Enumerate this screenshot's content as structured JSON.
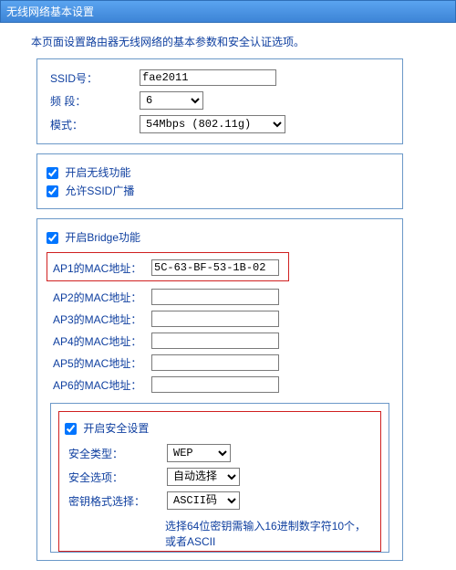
{
  "titlebar": "无线网络基本设置",
  "description": "本页面设置路由器无线网络的基本参数和安全认证选项。",
  "basic": {
    "ssid_label": "SSID号：",
    "ssid_value": "fae2011",
    "band_label": "频 段：",
    "band_value": "6",
    "mode_label": "模式：",
    "mode_value": "54Mbps (802.11g)"
  },
  "features": {
    "enable_wireless": "开启无线功能",
    "allow_ssid_broadcast": "允许SSID广播"
  },
  "bridge": {
    "enable_bridge": "开启Bridge功能",
    "ap_labels": [
      "AP1的MAC地址：",
      "AP2的MAC地址：",
      "AP3的MAC地址：",
      "AP4的MAC地址：",
      "AP5的MAC地址：",
      "AP6的MAC地址："
    ],
    "ap_values": [
      "5C-63-BF-53-1B-02",
      "",
      "",
      "",
      "",
      ""
    ]
  },
  "security": {
    "enable_security": "开启安全设置",
    "type_label": "安全类型：",
    "type_value": "WEP",
    "option_label": "安全选项：",
    "option_value": "自动选择",
    "keyfmt_label": "密钥格式选择：",
    "keyfmt_value": "ASCII码",
    "hint": "选择64位密钥需输入16进制数字符10个，或者ASCII"
  }
}
